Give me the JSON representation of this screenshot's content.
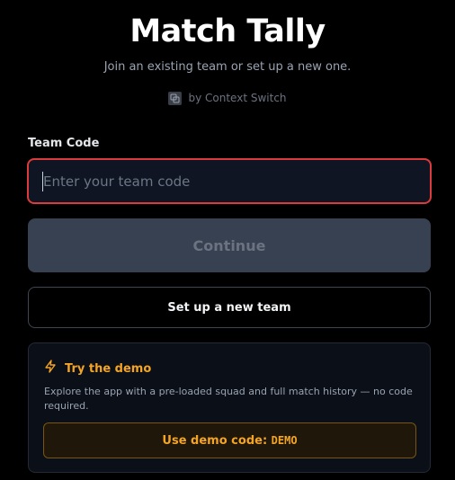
{
  "app": {
    "title": "Match Tally",
    "subtitle": "Join an existing team or set up a new one.",
    "byline": "by Context Switch"
  },
  "join_form": {
    "label": "Team Code",
    "input_value": "",
    "input_placeholder": "Enter your team code",
    "continue_label": "Continue",
    "setup_label": "Set up a new team"
  },
  "demo": {
    "heading": "Try the demo",
    "description": "Explore the app with a pre-loaded squad and full match history — no code required.",
    "button_prefix": "Use demo code: ",
    "button_code": "DEMO",
    "icon": "lightning-icon"
  },
  "colors": {
    "background": "#000000",
    "accent_amber": "#f5a524",
    "error_border": "#dc3b3b",
    "disabled_button": "#374151"
  }
}
